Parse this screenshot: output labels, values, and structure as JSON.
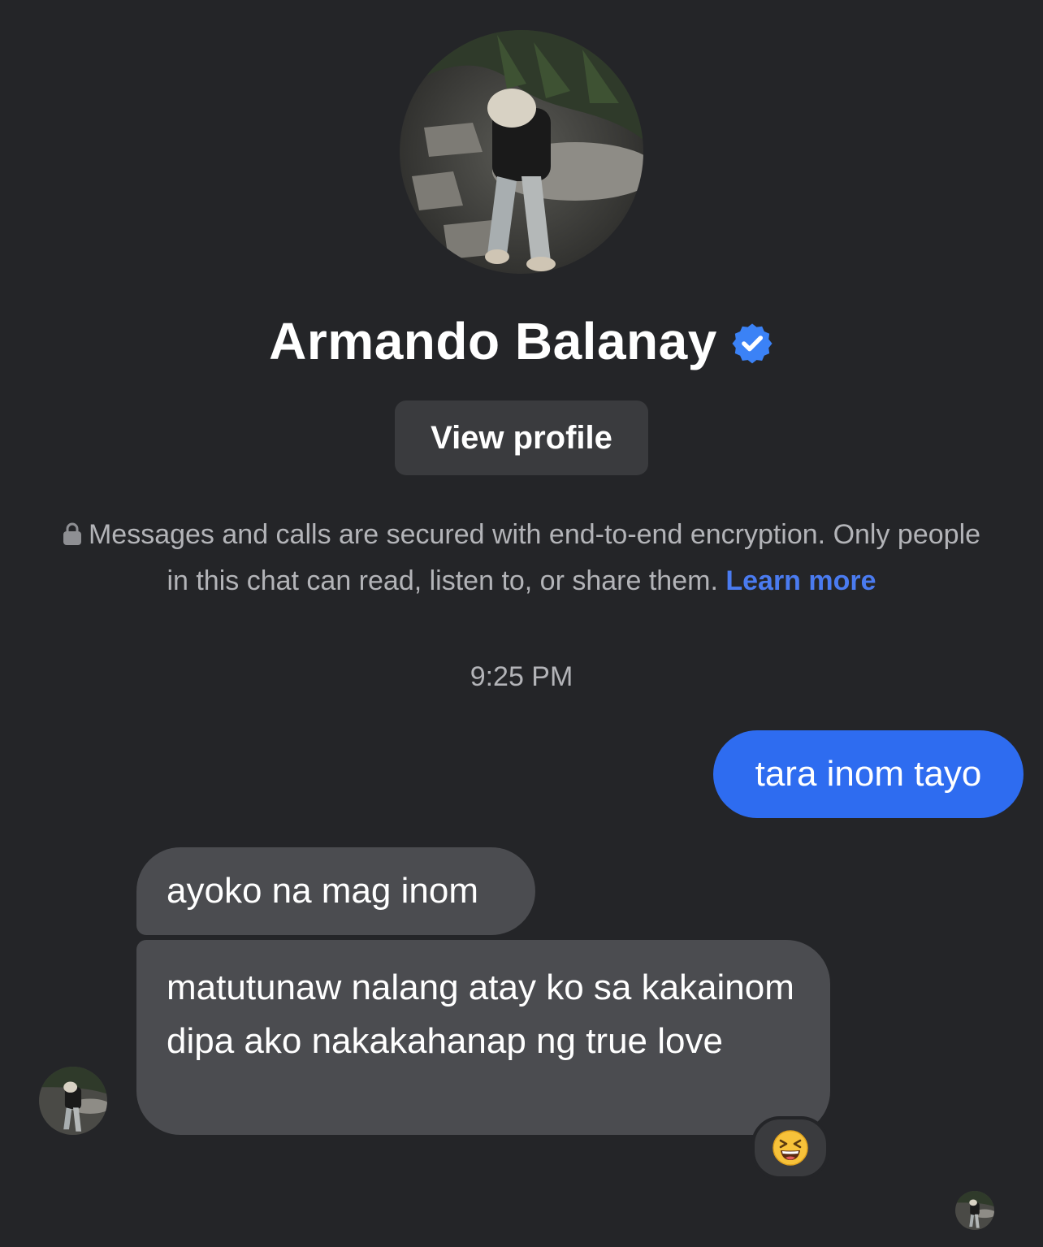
{
  "contact": {
    "name": "Armando Balanay",
    "verified_icon": "verified-badge-icon",
    "avatar": "profile-photo"
  },
  "header": {
    "view_profile_label": "View profile"
  },
  "encryption_notice": {
    "text": "Messages and calls are secured with end-to-end encryption. Only people in this chat can read, listen to, or share them.",
    "link_label": "Learn more",
    "icon": "lock-icon"
  },
  "conversation": {
    "timestamp": "9:25 PM",
    "messages": [
      {
        "from": "me",
        "text": "tara inom tayo"
      },
      {
        "from": "contact",
        "text": "ayoko na mag inom"
      },
      {
        "from": "contact",
        "text": "matutunaw nalang atay ko sa kakainom dipa ako nakakahanap ng true love",
        "reaction": "grinning-squinting-face-emoji"
      }
    ]
  },
  "colors": {
    "background": "#242528",
    "outgoing_bubble": "#2e6cf0",
    "incoming_bubble": "#4b4c50",
    "link": "#4a7bf0",
    "verified": "#3b82f6"
  }
}
